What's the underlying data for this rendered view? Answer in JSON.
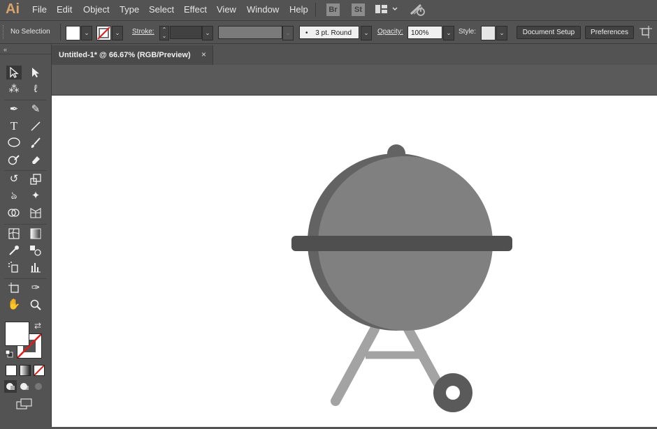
{
  "app": {
    "logo": "Ai"
  },
  "menu": [
    "File",
    "Edit",
    "Object",
    "Type",
    "Select",
    "Effect",
    "View",
    "Window",
    "Help"
  ],
  "bridge": {
    "br": "Br",
    "st": "St"
  },
  "control": {
    "selection": "No Selection",
    "stroke_label": "Stroke:",
    "brush": "3 pt. Round",
    "opacity_label": "Opacity:",
    "opacity_value": "100%",
    "style_label": "Style:",
    "document_setup": "Document Setup",
    "preferences": "Preferences"
  },
  "document": {
    "tab_title": "Untitled-1* @ 66.67% (RGB/Preview)",
    "close": "×"
  },
  "icons": [
    "selection-tool-icon",
    "direct-selection-tool-icon",
    "magic-wand-icon",
    "lasso-icon",
    "pen-icon",
    "curvature-icon",
    "type-icon",
    "line-icon",
    "ellipse-icon",
    "paintbrush-icon",
    "shaper-icon",
    "eraser-icon",
    "rotate-icon",
    "scale-icon",
    "warp-icon",
    "puppet-warp-icon",
    "shape-builder-icon",
    "perspective-grid-icon",
    "mesh-icon",
    "gradient-icon",
    "eyedropper-icon",
    "blend-icon",
    "symbol-sprayer-icon",
    "column-graph-icon",
    "artboard-icon",
    "slice-icon",
    "hand-icon",
    "zoom-icon"
  ],
  "colors": {
    "grill_dark": "#636363",
    "grill_main": "#808080",
    "grill_band": "#4f4f4f",
    "legs": "#a3a3a3",
    "wheel": "#5a5a5a"
  }
}
